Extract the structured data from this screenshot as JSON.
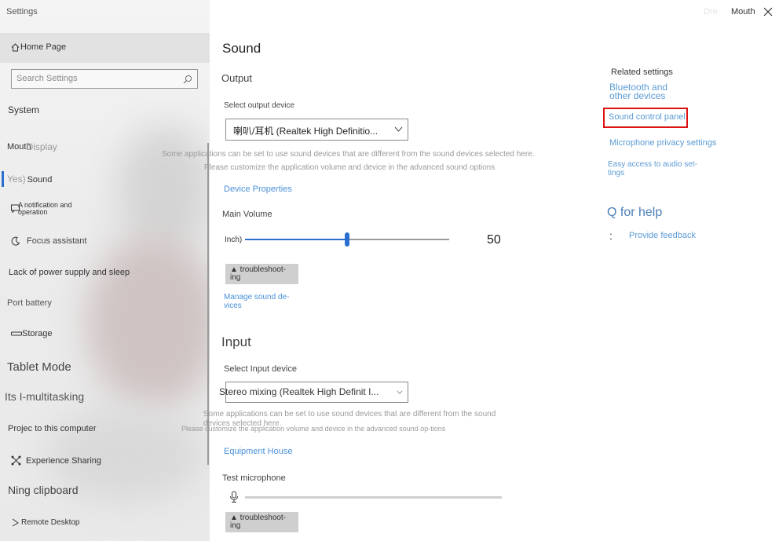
{
  "window": {
    "title": "Settings",
    "top_right_faint": "Dre",
    "top_right_label": "Mouth"
  },
  "sidebar": {
    "home": "Home Page",
    "search_placeholder": "Search Settings",
    "section": "System",
    "items": [
      {
        "prefix": "Mouth",
        "label": "Display"
      },
      {
        "prefix": "Yes)",
        "label": "Sound"
      },
      {
        "label": "A notification and operation"
      },
      {
        "label": "Focus assistant"
      },
      {
        "label": "Lack of power supply and sleep"
      },
      {
        "label": "Port battery"
      },
      {
        "label": "Storage"
      },
      {
        "label": "Tablet Mode"
      },
      {
        "label": "Its I-multitasking"
      },
      {
        "label": "Projec to this computer"
      },
      {
        "label": "Experience Sharing"
      },
      {
        "label": "Ning clipboard"
      },
      {
        "label": "Remote Desktop"
      }
    ]
  },
  "main": {
    "title": "Sound",
    "output": {
      "heading": "Output",
      "select_label": "Select output device",
      "device": "喇叭/耳机 (Realtek High Definitio...",
      "note_line1": "Some applications can be set to use sound devices that are different from the sound devices selected here.",
      "note_line2": "Please customize the application volume and device in the advanced sound options",
      "device_properties": "Device Properties",
      "volume_label": "Main Volume",
      "volume_icon_text": "Inch)",
      "volume_value": "50",
      "volume_level": 0.5,
      "troubleshoot": "▲ troubleshoot-ing",
      "manage": "Manage sound de-vices"
    },
    "input": {
      "heading": "Input",
      "select_label": "Select Input device",
      "device": "Stereo mixing (Realtek High Definit I...",
      "note_line1": "Some applications can be set to use sound devices that are different from the sound devices selected here.",
      "note_line2": "Please customize the application volume and device in the advanced sound op-tions",
      "equipment": "Equipment House",
      "test_label": "Test microphone",
      "mic_level": 0,
      "troubleshoot": "▲ troubleshoot-ing"
    }
  },
  "related": {
    "title": "Related settings",
    "bluetooth": "Bluetooth and other devices",
    "sound_panel": "Sound control panel",
    "mic_privacy": "Microphone privacy settings",
    "easy_access": "Easy access to audio set-tings",
    "help_title": "Q for help",
    "help_icon_text": ":",
    "feedback": "Provide feedback"
  },
  "colors": {
    "accent": "#2a6fd0",
    "link": "#4a90d9",
    "highlight": "#dd1111"
  }
}
